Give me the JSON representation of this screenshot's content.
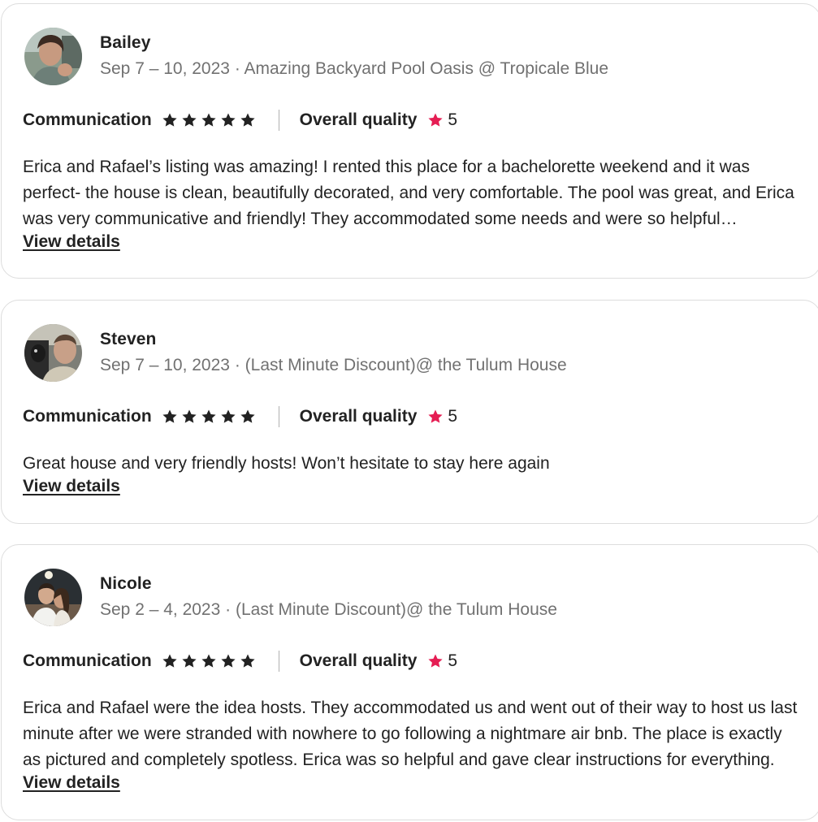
{
  "reviews": [
    {
      "name": "Bailey",
      "date": "Sep 7 – 10, 2023",
      "listing": "Amazing Backyard Pool Oasis @ Tropicale Blue",
      "communication_label": "Communication",
      "communication_stars": 5,
      "quality_label": "Overall quality",
      "quality_value": "5",
      "text": "Erica and Rafael’s listing was amazing! I rented this place for a bachelorette weekend and it was perfect- the house is clean, beautifully decorated, and very comfortable. The pool was great, and Erica was very communicative and friendly! They accommodated some needs and were so helpful throughout our stay.",
      "link": "View details"
    },
    {
      "name": "Steven",
      "date": "Sep 7 – 10, 2023",
      "listing": "(Last Minute Discount)@ the Tulum House",
      "communication_label": "Communication",
      "communication_stars": 5,
      "quality_label": "Overall quality",
      "quality_value": "5",
      "text": "Great house and very friendly hosts! Won’t hesitate to stay here again",
      "link": "View details"
    },
    {
      "name": "Nicole",
      "date": "Sep 2 – 4, 2023",
      "listing": "(Last Minute Discount)@ the Tulum House",
      "communication_label": "Communication",
      "communication_stars": 5,
      "quality_label": "Overall quality",
      "quality_value": "5",
      "text": "Erica and Rafael were the idea hosts. They accommodated us and went out of their way to host us last minute after we were stranded with nowhere to go following a nightmare air bnb. The place is exactly as pictured and completely spotless. Erica was so helpful and gave clear instructions for everything.",
      "link": "View details"
    }
  ],
  "separator": "·",
  "colors": {
    "text": "#222222",
    "muted": "#717171",
    "border": "#dddddd",
    "accent_star": "#e51d53"
  },
  "icons": {
    "communication_star": "star-icon",
    "quality_star": "star-icon-accent"
  }
}
